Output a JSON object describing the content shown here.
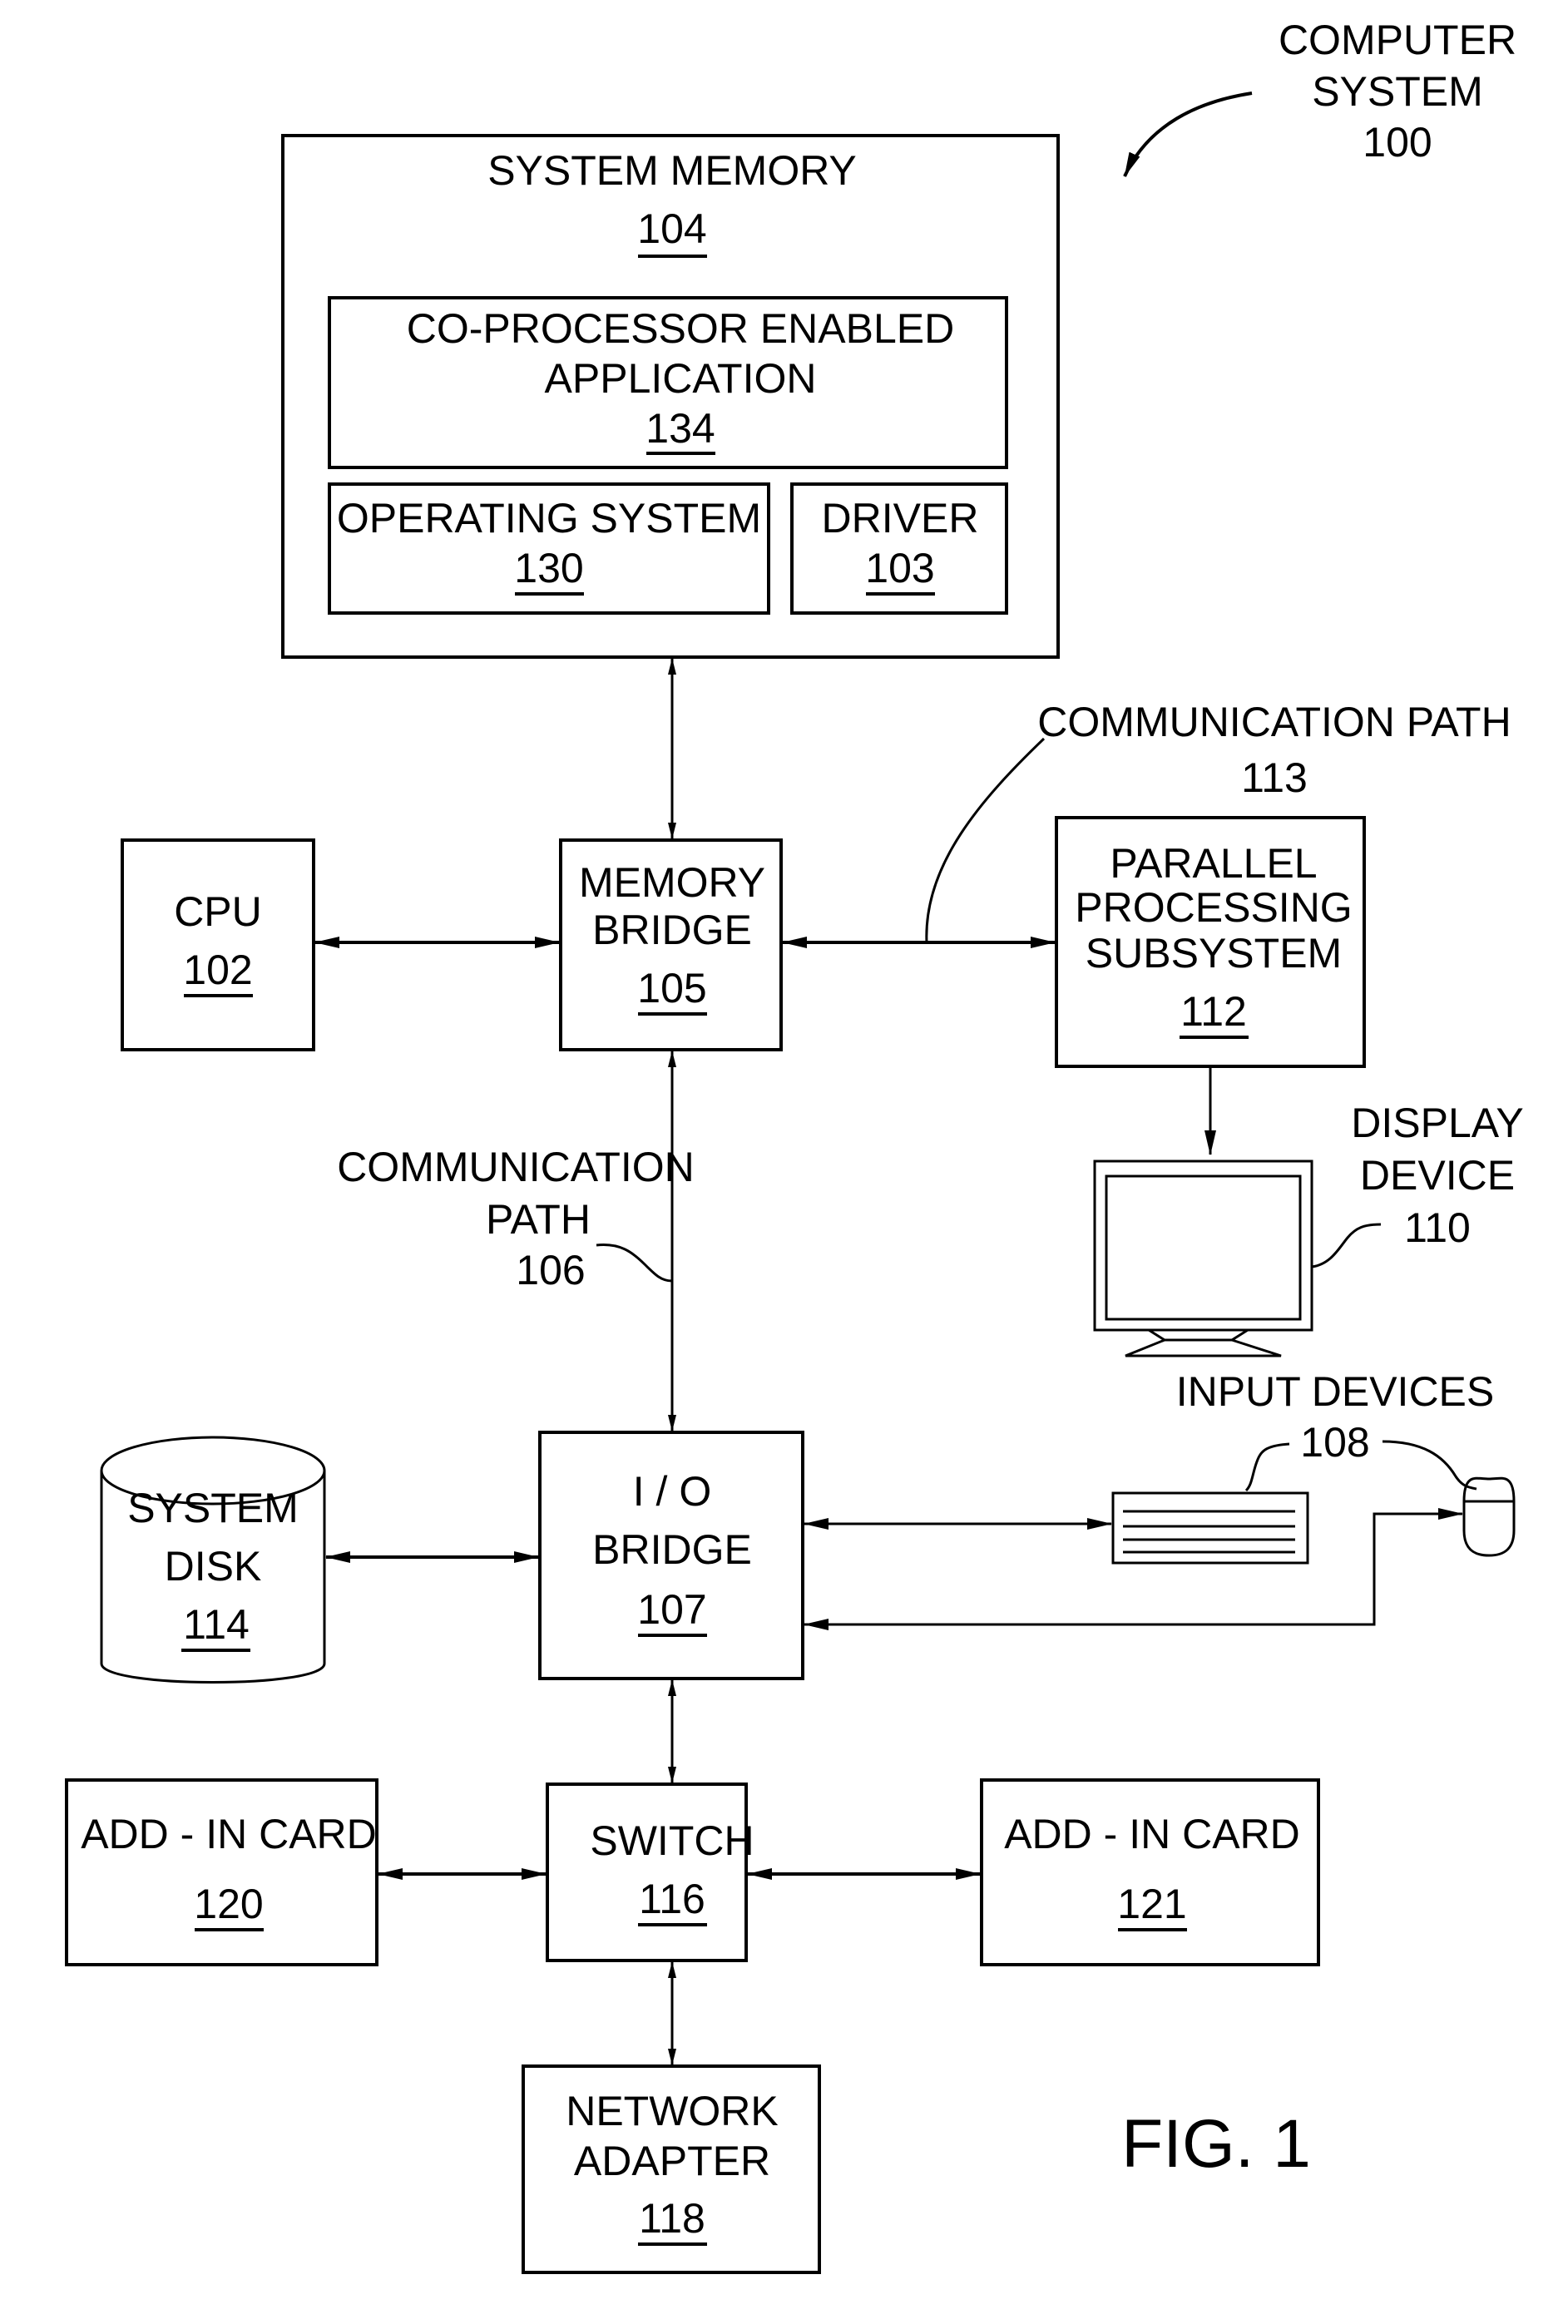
{
  "figure_label": "FIG. 1",
  "computer_system": {
    "title_line1": "COMPUTER",
    "title_line2": "SYSTEM",
    "ref": "100"
  },
  "system_memory": {
    "title": "SYSTEM MEMORY",
    "ref": "104"
  },
  "coprocessor_app": {
    "line1": "CO-PROCESSOR ENABLED",
    "line2": "APPLICATION",
    "ref": "134"
  },
  "operating_system": {
    "title": "OPERATING SYSTEM",
    "ref": "130"
  },
  "driver": {
    "title": "DRIVER",
    "ref": "103"
  },
  "cpu": {
    "title": "CPU",
    "ref": "102"
  },
  "memory_bridge": {
    "line1": "MEMORY",
    "line2": "BRIDGE",
    "ref": "105"
  },
  "communication_path_113": {
    "title": "COMMUNICATION PATH",
    "ref": "113"
  },
  "parallel_processing": {
    "line1": "PARALLEL",
    "line2": "PROCESSING",
    "line3": "SUBSYSTEM",
    "ref": "112"
  },
  "display_device": {
    "line1": "DISPLAY",
    "line2": "DEVICE",
    "ref": "110"
  },
  "communication_path_106": {
    "line1": "COMMUNICATION",
    "line2": "PATH",
    "ref": "106"
  },
  "input_devices": {
    "title": "INPUT  DEVICES",
    "ref": "108"
  },
  "system_disk": {
    "line1": "SYSTEM",
    "line2": "DISK",
    "ref": "114"
  },
  "io_bridge": {
    "line1": "I / O",
    "line2": "BRIDGE",
    "ref": "107"
  },
  "add_in_card_120": {
    "title": "ADD - IN CARD",
    "ref": "120"
  },
  "switch": {
    "title": "SWITCH",
    "ref": "116"
  },
  "add_in_card_121": {
    "title": "ADD - IN CARD",
    "ref": "121"
  },
  "network_adapter": {
    "line1": "NETWORK",
    "line2": "ADAPTER",
    "ref": "118"
  }
}
